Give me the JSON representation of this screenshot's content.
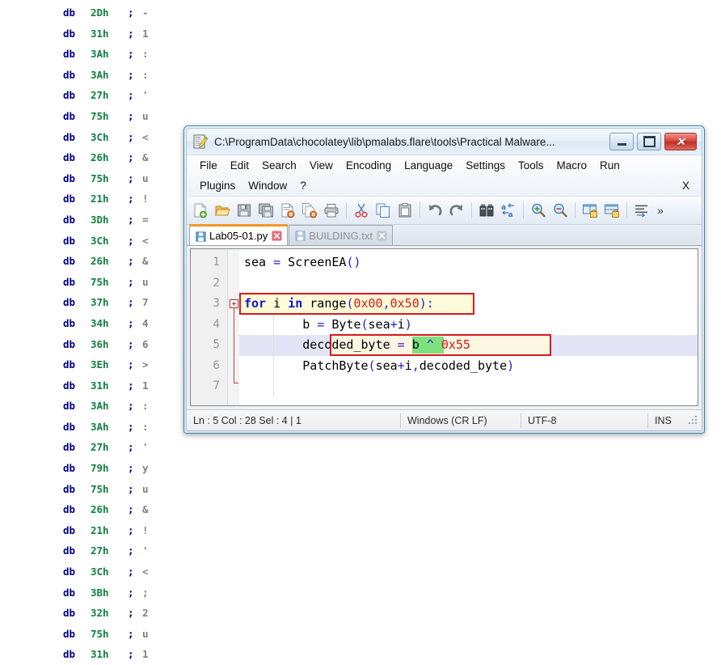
{
  "disassembly": {
    "mnemonic": "db",
    "rows": [
      {
        "value": "2Dh",
        "comment": "-"
      },
      {
        "value": "31h",
        "comment": "1"
      },
      {
        "value": "3Ah",
        "comment": ":"
      },
      {
        "value": "3Ah",
        "comment": ":"
      },
      {
        "value": "27h",
        "comment": "'"
      },
      {
        "value": "75h",
        "comment": "u"
      },
      {
        "value": "3Ch",
        "comment": "<"
      },
      {
        "value": "26h",
        "comment": "&"
      },
      {
        "value": "75h",
        "comment": "u"
      },
      {
        "value": "21h",
        "comment": "!"
      },
      {
        "value": "3Dh",
        "comment": "="
      },
      {
        "value": "3Ch",
        "comment": "<"
      },
      {
        "value": "26h",
        "comment": "&"
      },
      {
        "value": "75h",
        "comment": "u"
      },
      {
        "value": "37h",
        "comment": "7"
      },
      {
        "value": "34h",
        "comment": "4"
      },
      {
        "value": "36h",
        "comment": "6"
      },
      {
        "value": "3Eh",
        "comment": ">"
      },
      {
        "value": "31h",
        "comment": "1"
      },
      {
        "value": "3Ah",
        "comment": ":"
      },
      {
        "value": "3Ah",
        "comment": ":"
      },
      {
        "value": "27h",
        "comment": "'"
      },
      {
        "value": "79h",
        "comment": "y"
      },
      {
        "value": "75h",
        "comment": "u"
      },
      {
        "value": "26h",
        "comment": "&"
      },
      {
        "value": "21h",
        "comment": "!"
      },
      {
        "value": "27h",
        "comment": "'"
      },
      {
        "value": "3Ch",
        "comment": "<"
      },
      {
        "value": "3Bh",
        "comment": ";"
      },
      {
        "value": "32h",
        "comment": "2"
      },
      {
        "value": "75h",
        "comment": "u"
      },
      {
        "value": "31h",
        "comment": "1"
      }
    ],
    "separator": ";",
    "colors": {
      "mnemonic": "#00007f",
      "value": "#108040",
      "comment": "#808080"
    }
  },
  "window": {
    "title": "C:\\ProgramData\\chocolatey\\lib\\pmalabs.flare\\tools\\Practical Malware...",
    "icon": "notepad-plus-plus-icon",
    "buttons": {
      "minimize": "minimize-button",
      "maximize": "maximize-button",
      "close": "close-button",
      "close_glyph": "✕"
    },
    "accent_border": "#3f87a6"
  },
  "menubar": {
    "row1": [
      "File",
      "Edit",
      "Search",
      "View",
      "Encoding",
      "Language",
      "Settings",
      "Tools",
      "Macro",
      "Run"
    ],
    "row2": [
      "Plugins",
      "Window",
      "?"
    ],
    "close_doc": "X"
  },
  "toolbar": {
    "groups": [
      [
        "new-file-icon",
        "open-file-icon",
        "save-icon",
        "save-all-icon",
        "close-file-icon",
        "close-all-icon",
        "print-icon"
      ],
      [
        "cut-icon",
        "copy-icon",
        "paste-icon"
      ],
      [
        "undo-icon",
        "redo-icon"
      ],
      [
        "find-icon",
        "replace-icon"
      ],
      [
        "zoom-in-icon",
        "zoom-out-icon"
      ],
      [
        "sync-vertical-scroll-icon",
        "sync-horizontal-scroll-icon"
      ],
      [
        "word-wrap-icon"
      ]
    ],
    "overflow": "»"
  },
  "tabs": [
    {
      "label": "Lab05-01.py",
      "active": true,
      "close": "✕"
    },
    {
      "label": "BUILDING.txt",
      "active": false,
      "close": "✕"
    }
  ],
  "editor": {
    "language": "Python",
    "current_line": 5,
    "lines": [
      {
        "num": "1",
        "tokens": [
          {
            "t": "sea ",
            "c": "plain"
          },
          {
            "t": "=",
            "c": "op"
          },
          {
            "t": " ScreenEA",
            "c": "plain"
          },
          {
            "t": "()",
            "c": "op"
          }
        ]
      },
      {
        "num": "2",
        "tokens": []
      },
      {
        "num": "3",
        "tokens": [
          {
            "t": "for",
            "c": "kw"
          },
          {
            "t": " i ",
            "c": "plain"
          },
          {
            "t": "in",
            "c": "kw"
          },
          {
            "t": " range",
            "c": "plain"
          },
          {
            "t": "(",
            "c": "op"
          },
          {
            "t": "0x00",
            "c": "num"
          },
          {
            "t": ",",
            "c": "op"
          },
          {
            "t": "0x50",
            "c": "num"
          },
          {
            "t": "):",
            "c": "op"
          }
        ]
      },
      {
        "num": "4",
        "tokens": [
          {
            "t": "        b ",
            "c": "plain"
          },
          {
            "t": "=",
            "c": "op"
          },
          {
            "t": " Byte",
            "c": "plain"
          },
          {
            "t": "(",
            "c": "op"
          },
          {
            "t": "sea",
            "c": "plain"
          },
          {
            "t": "+",
            "c": "op"
          },
          {
            "t": "i",
            "c": "plain"
          },
          {
            "t": ")",
            "c": "op"
          }
        ]
      },
      {
        "num": "5",
        "tokens": [
          {
            "t": "        decoded_byte ",
            "c": "plain"
          },
          {
            "t": "=",
            "c": "op"
          },
          {
            "t": " b ",
            "c": "plain"
          },
          {
            "t": "^",
            "c": "op"
          },
          {
            "t": " ",
            "c": "plain"
          },
          {
            "t": "0x55",
            "c": "num"
          }
        ]
      },
      {
        "num": "6",
        "tokens": [
          {
            "t": "        PatchByte",
            "c": "plain"
          },
          {
            "t": "(",
            "c": "op"
          },
          {
            "t": "sea",
            "c": "plain"
          },
          {
            "t": "+",
            "c": "op"
          },
          {
            "t": "i",
            "c": "plain"
          },
          {
            "t": ",",
            "c": "op"
          },
          {
            "t": "decoded_byte",
            "c": "plain"
          },
          {
            "t": ")",
            "c": "op"
          }
        ]
      },
      {
        "num": "7",
        "tokens": []
      }
    ],
    "fold_marker": "fold-expand-box",
    "annotations": {
      "loop_box": "red-highlight-box-for-loop",
      "xor_box": "red-highlight-box-xor-line",
      "xor_key_highlight": "0x55",
      "highlight_color": "#7ee07e",
      "box_color": "#d71920"
    }
  },
  "statusbar": {
    "position": "Ln : 5   Col : 28   Sel : 4 | 1",
    "eol": "Windows (CR LF)",
    "encoding": "UTF-8",
    "insert_mode": "INS"
  }
}
